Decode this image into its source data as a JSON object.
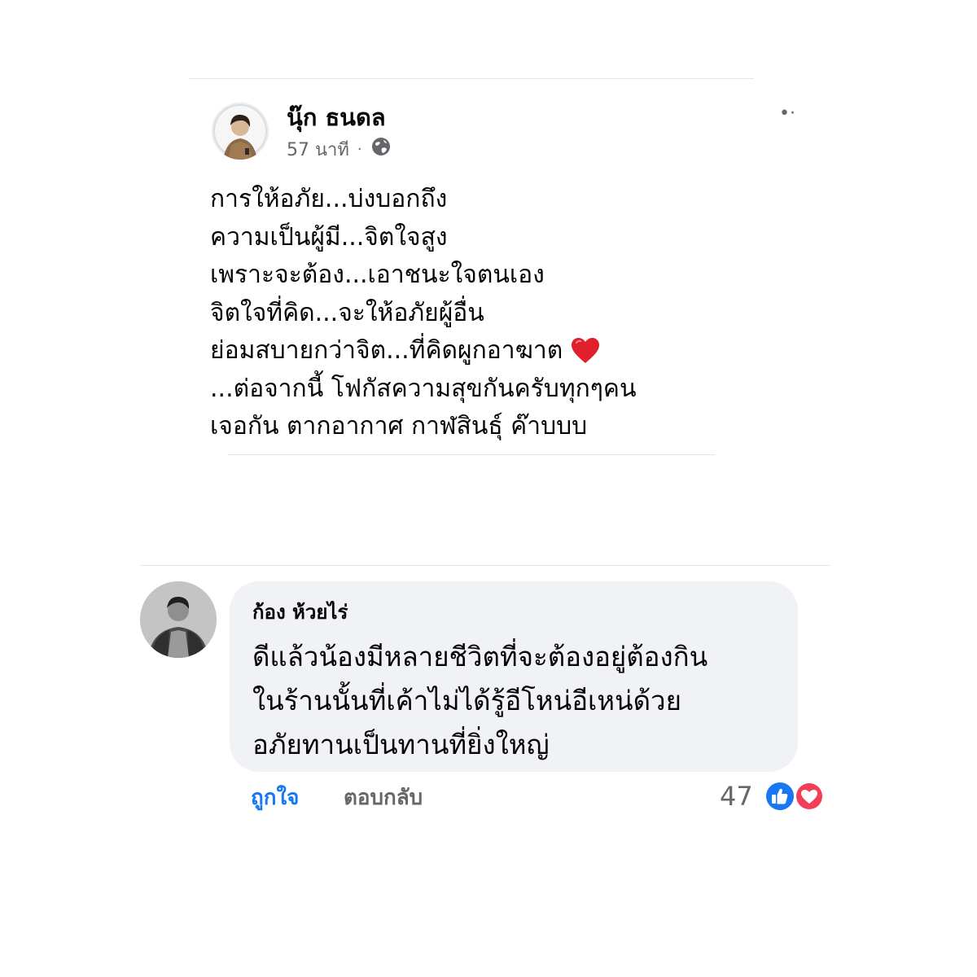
{
  "post": {
    "author": "นุ๊ก ธนดล",
    "time": "57 นาที",
    "meta_separator": "·",
    "more_glyph": "•·",
    "lines": [
      "การให้อภัย...บ่งบอกถึง",
      "ความเป็นผู้มี...จิตใจสูง",
      "เพราะจะต้อง...เอาชนะใจตนเอง",
      "จิตใจที่คิด...จะให้อภัยผู้อื่น",
      "ย่อมสบายกว่าจิต...ที่คิดผูกอาฆาต",
      "...ต่อจากนี้ โฟกัสความสุขกันครับทุกๆคน",
      "เจอกัน ตากอากาศ กาฬสินธุ์ ค๊าบบบ"
    ],
    "icons": {
      "privacy": "globe-icon",
      "emoji": "red-heart-icon"
    }
  },
  "comment": {
    "author": "ก้อง ห้วยไร่",
    "lines": [
      "ดีแล้วน้องมีหลายชีวิตที่จะต้องอยู่ต้องกิน",
      "ในร้านนั้นที่เค้าไม่ได้รู้อีโหน่อีเหน่ด้วย",
      "อภัยทานเป็นทานที่ยิ่งใหญ่"
    ],
    "actions": {
      "like": "ถูกใจ",
      "reply": "ตอบกลับ"
    },
    "reactions": {
      "count": "47",
      "types": [
        "like-reaction-icon",
        "love-reaction-icon"
      ]
    }
  },
  "colors": {
    "text": "#050505",
    "secondary": "#65676b",
    "link_blue": "#1877f2",
    "bubble": "#f0f2f5",
    "love_red": "#f33e58"
  }
}
